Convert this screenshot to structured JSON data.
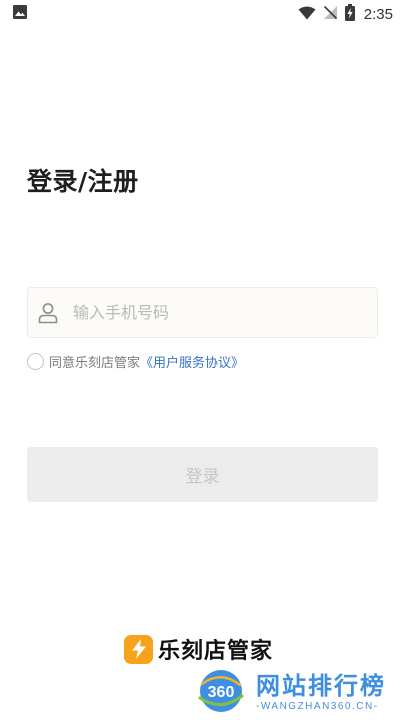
{
  "status_bar": {
    "time": "2:35",
    "icons": [
      "image-icon",
      "wifi-icon",
      "no-signal-icon",
      "battery-charging-icon"
    ]
  },
  "login": {
    "title": "登录/注册",
    "phone_placeholder": "输入手机号码",
    "phone_value": "",
    "agreement_text": "同意乐刻店管家",
    "agreement_link": "《用户服务协议》",
    "agreement_checked": false,
    "login_button": "登录"
  },
  "brand": {
    "name": "乐刻店管家",
    "logo_icon": "lightning-icon",
    "color": "#f7a21b"
  },
  "watermark": {
    "logo_text": "360",
    "name": "网站排行榜",
    "domain": "-WANGZHAN360.CN-",
    "color": "#3f8fe0"
  }
}
